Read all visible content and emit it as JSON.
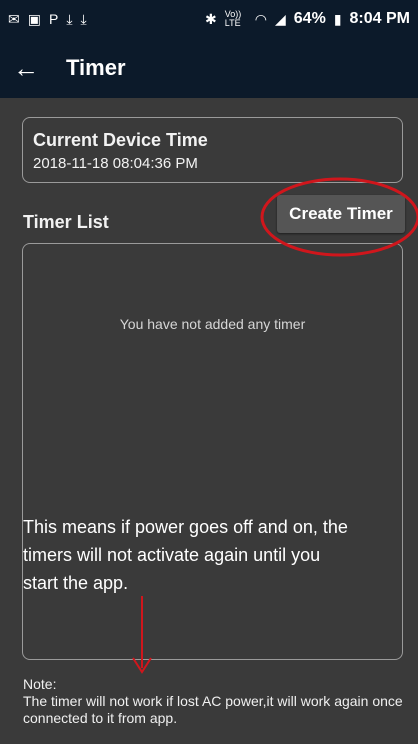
{
  "status_bar": {
    "left_icons": [
      "mail-icon",
      "gallery-icon",
      "paypal-icon",
      "download-icon",
      "download-icon"
    ],
    "right_icons": [
      "bluetooth-icon",
      "volte-icon",
      "wifi-icon",
      "signal-icon",
      "battery-icon"
    ],
    "volte_text": "Vo)) LTE",
    "battery_percent": "64%",
    "time": "8:04 PM"
  },
  "app_bar": {
    "title": "Timer",
    "back_icon": "back-arrow-icon"
  },
  "device_time": {
    "label": "Current Device Time",
    "value": "2018-11-18 08:04:36 PM"
  },
  "timer_list": {
    "label": "Timer List",
    "create_button": "Create Timer",
    "empty_message": "You have not added any timer"
  },
  "annotation": {
    "text": "This means if power goes off and on, the timers will not activate again until you start the app.",
    "color": "#d0161c"
  },
  "note": {
    "title": "Note:",
    "text": "The timer will not work if lost AC power,it will work again once connected to it from app."
  },
  "colors": {
    "bar_bg": "#0c1a2a",
    "page_bg": "#3a3a3a",
    "button_bg": "#555555",
    "annotation_red": "#d0161c"
  }
}
